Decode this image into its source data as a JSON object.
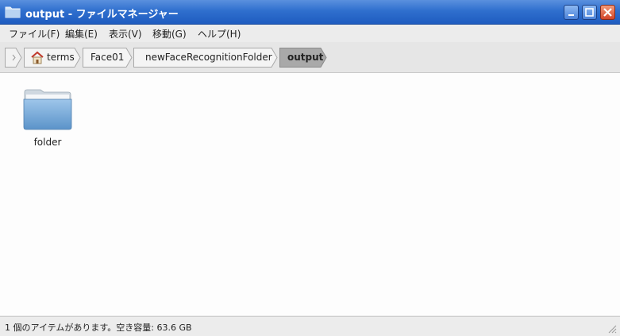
{
  "window": {
    "title": "output - ファイルマネージャー",
    "title_icon": "folder-icon",
    "controls": {
      "minimize": "minimize-icon",
      "maximize": "maximize-icon",
      "close": "close-icon"
    }
  },
  "menu": [
    {
      "id": "file",
      "label": "ファイル(F)"
    },
    {
      "id": "edit",
      "label": "編集(E)"
    },
    {
      "id": "view",
      "label": "表示(V)"
    },
    {
      "id": "go",
      "label": "移動(G)"
    },
    {
      "id": "help",
      "label": "ヘルプ(H)"
    }
  ],
  "breadcrumbs": [
    {
      "label": "terms",
      "icon": "home-icon"
    },
    {
      "label": "Face01"
    },
    {
      "label": "newFaceRecognitionFolder"
    },
    {
      "label": "output",
      "active": true
    }
  ],
  "files": [
    {
      "name": "folder",
      "icon": "folder-icon"
    }
  ],
  "status": {
    "text": "1 個のアイテムがあります。空き容量: 63.6 GB"
  },
  "colors": {
    "titlebar": "#2f6fce",
    "active_crumb": "#a7a7a7",
    "background": "#fdfdfd"
  }
}
